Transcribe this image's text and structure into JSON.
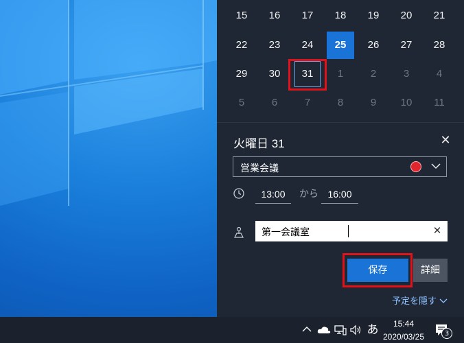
{
  "calendar": {
    "rows": [
      [
        {
          "d": "15"
        },
        {
          "d": "16"
        },
        {
          "d": "17"
        },
        {
          "d": "18"
        },
        {
          "d": "19"
        },
        {
          "d": "20"
        },
        {
          "d": "21"
        }
      ],
      [
        {
          "d": "22"
        },
        {
          "d": "23"
        },
        {
          "d": "24"
        },
        {
          "d": "25",
          "today": true
        },
        {
          "d": "26"
        },
        {
          "d": "27"
        },
        {
          "d": "28"
        }
      ],
      [
        {
          "d": "29"
        },
        {
          "d": "30"
        },
        {
          "d": "31",
          "selected": true
        },
        {
          "d": "1",
          "dim": true
        },
        {
          "d": "2",
          "dim": true
        },
        {
          "d": "3",
          "dim": true
        },
        {
          "d": "4",
          "dim": true
        }
      ],
      [
        {
          "d": "5",
          "dim": true
        },
        {
          "d": "6",
          "dim": true
        },
        {
          "d": "7",
          "dim": true
        },
        {
          "d": "8",
          "dim": true
        },
        {
          "d": "9",
          "dim": true
        },
        {
          "d": "10",
          "dim": true
        },
        {
          "d": "11",
          "dim": true
        }
      ]
    ]
  },
  "event": {
    "date_title": "火曜日 31",
    "name": "営業会議",
    "color": "#e0262f",
    "start_time": "13:00",
    "time_separator": "から",
    "end_time": "16:00",
    "location": "第一会議室",
    "save_label": "保存",
    "details_label": "詳細",
    "hide_label": "予定を隠す"
  },
  "taskbar": {
    "ime_label": "あ",
    "time": "15:44",
    "date": "2020/03/25",
    "notification_count": "3"
  },
  "icons": [
    "close-icon",
    "chevron-down-icon",
    "clock-icon",
    "location-icon",
    "clear-icon",
    "chevron-up-icon",
    "onedrive-icon",
    "network-icon",
    "volume-icon",
    "notification-icon"
  ]
}
